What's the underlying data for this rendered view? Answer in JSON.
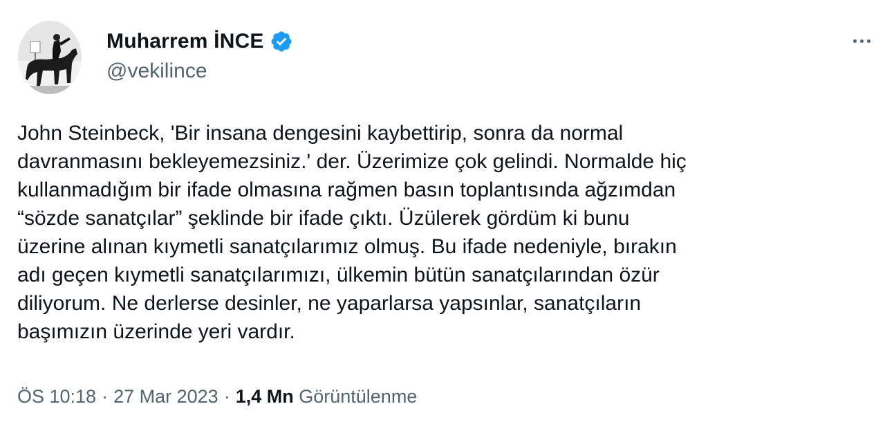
{
  "author": {
    "display_name": "Muharrem İNCE",
    "handle": "@vekilince",
    "verified_icon": "verified-badge-icon",
    "verified_color": "#1d9bf0"
  },
  "more_icon": "more-horizontal-icon",
  "tweet": {
    "lines": [
      "John Steinbeck, 'Bir insana dengesini kaybettirip, sonra da normal",
      "davranmasını bekleyemezsiniz.' der. Üzerimize çok gelindi. Normalde hiç",
      "kullanmadığım bir ifade olmasına rağmen basın toplantısında ağzımdan",
      "“sözde sanatçılar” şeklinde bir ifade çıktı. Üzülerek gördüm ki bunu",
      "üzerine alınan kıymetli sanatçılarımız olmuş. Bu ifade nedeniyle, bırakın",
      "adı geçen kıymetli sanatçılarımızı, ülkemin bütün sanatçılarından özür",
      "diliyorum. Ne derlerse desinler, ne yaparlarsa yapsınlar, sanatçıların",
      "başımızın üzerinde yeri vardır."
    ]
  },
  "meta": {
    "time": "ÖS 10:18",
    "separator": "·",
    "date": "27 Mar 2023",
    "views_count": "1,4 Mn",
    "views_label": "Görüntülenme"
  },
  "colors": {
    "text_primary": "#0f1419",
    "text_secondary": "#536471",
    "background": "#ffffff"
  }
}
